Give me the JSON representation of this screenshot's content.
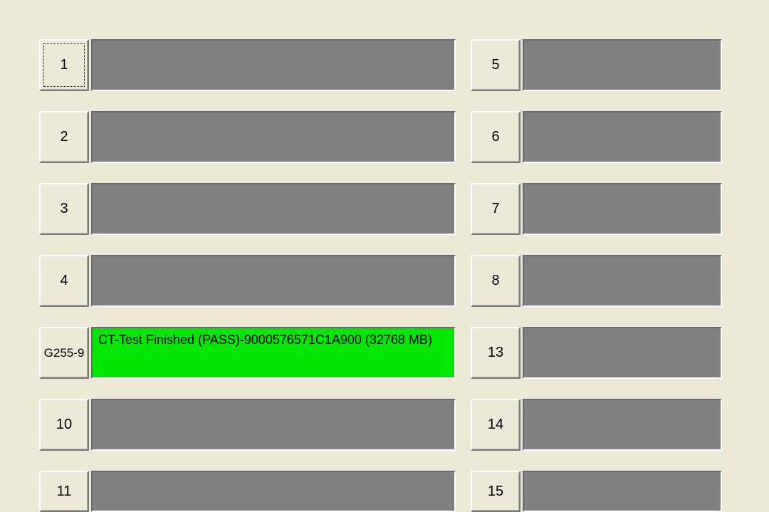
{
  "colors": {
    "pass": "#00e600",
    "panel_default": "#808080",
    "background": "#ece9d8"
  },
  "left_slots": [
    {
      "label": "1",
      "status": "",
      "focused": true,
      "state": "empty"
    },
    {
      "label": "2",
      "status": "",
      "focused": false,
      "state": "empty"
    },
    {
      "label": "3",
      "status": "",
      "focused": false,
      "state": "empty"
    },
    {
      "label": "4",
      "status": "",
      "focused": false,
      "state": "empty"
    },
    {
      "label": "G255-9",
      "status": "CT-Test Finished (PASS)-9000576571C1A900 (32768 MB)",
      "focused": false,
      "state": "pass"
    },
    {
      "label": "10",
      "status": "",
      "focused": false,
      "state": "empty"
    },
    {
      "label": "11",
      "status": "",
      "focused": false,
      "state": "empty"
    }
  ],
  "right_slots": [
    {
      "label": "5",
      "status": "",
      "focused": false,
      "state": "empty"
    },
    {
      "label": "6",
      "status": "",
      "focused": false,
      "state": "empty"
    },
    {
      "label": "7",
      "status": "",
      "focused": false,
      "state": "empty"
    },
    {
      "label": "8",
      "status": "",
      "focused": false,
      "state": "empty"
    },
    {
      "label": "13",
      "status": "",
      "focused": false,
      "state": "empty"
    },
    {
      "label": "14",
      "status": "",
      "focused": false,
      "state": "empty"
    },
    {
      "label": "15",
      "status": "",
      "focused": false,
      "state": "empty"
    }
  ]
}
